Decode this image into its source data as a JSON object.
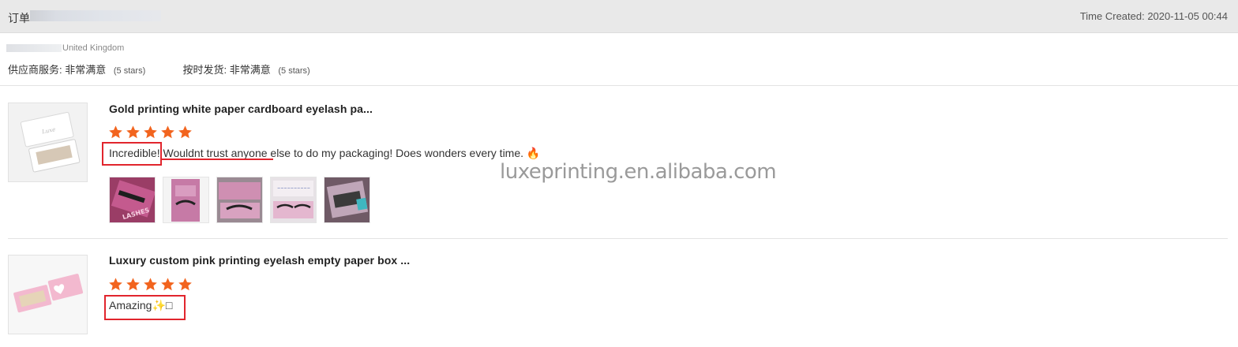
{
  "header": {
    "order_label": "订单",
    "time_created": "Time Created: 2020-11-05 00:44"
  },
  "buyer": {
    "country": "United Kingdom"
  },
  "ratings": {
    "supplier_service_label": "供应商服务:",
    "supplier_service_value": "非常满意",
    "supplier_service_stars": "(5 stars)",
    "on_time_label": "按时发货:",
    "on_time_value": "非常满意",
    "on_time_stars": "(5 stars)"
  },
  "reviews": [
    {
      "product_title": "Gold printing white paper cardboard eyelash pa...",
      "rating": 5,
      "text": "Incredible! Wouldnt trust anyone else to do my packaging! Does wonders every time. 🔥",
      "media_count": 5
    },
    {
      "product_title": "Luxury custom pink printing eyelash empty paper box ...",
      "rating": 5,
      "text": "Amazing✨□"
    }
  ],
  "watermark": "luxeprinting.en.alibaba.com",
  "colors": {
    "header_bg": "#e9e9e9",
    "star": "#f2641e",
    "highlight": "#e1252d"
  },
  "icons": {
    "star": "star-icon",
    "fire": "fire-emoji"
  }
}
